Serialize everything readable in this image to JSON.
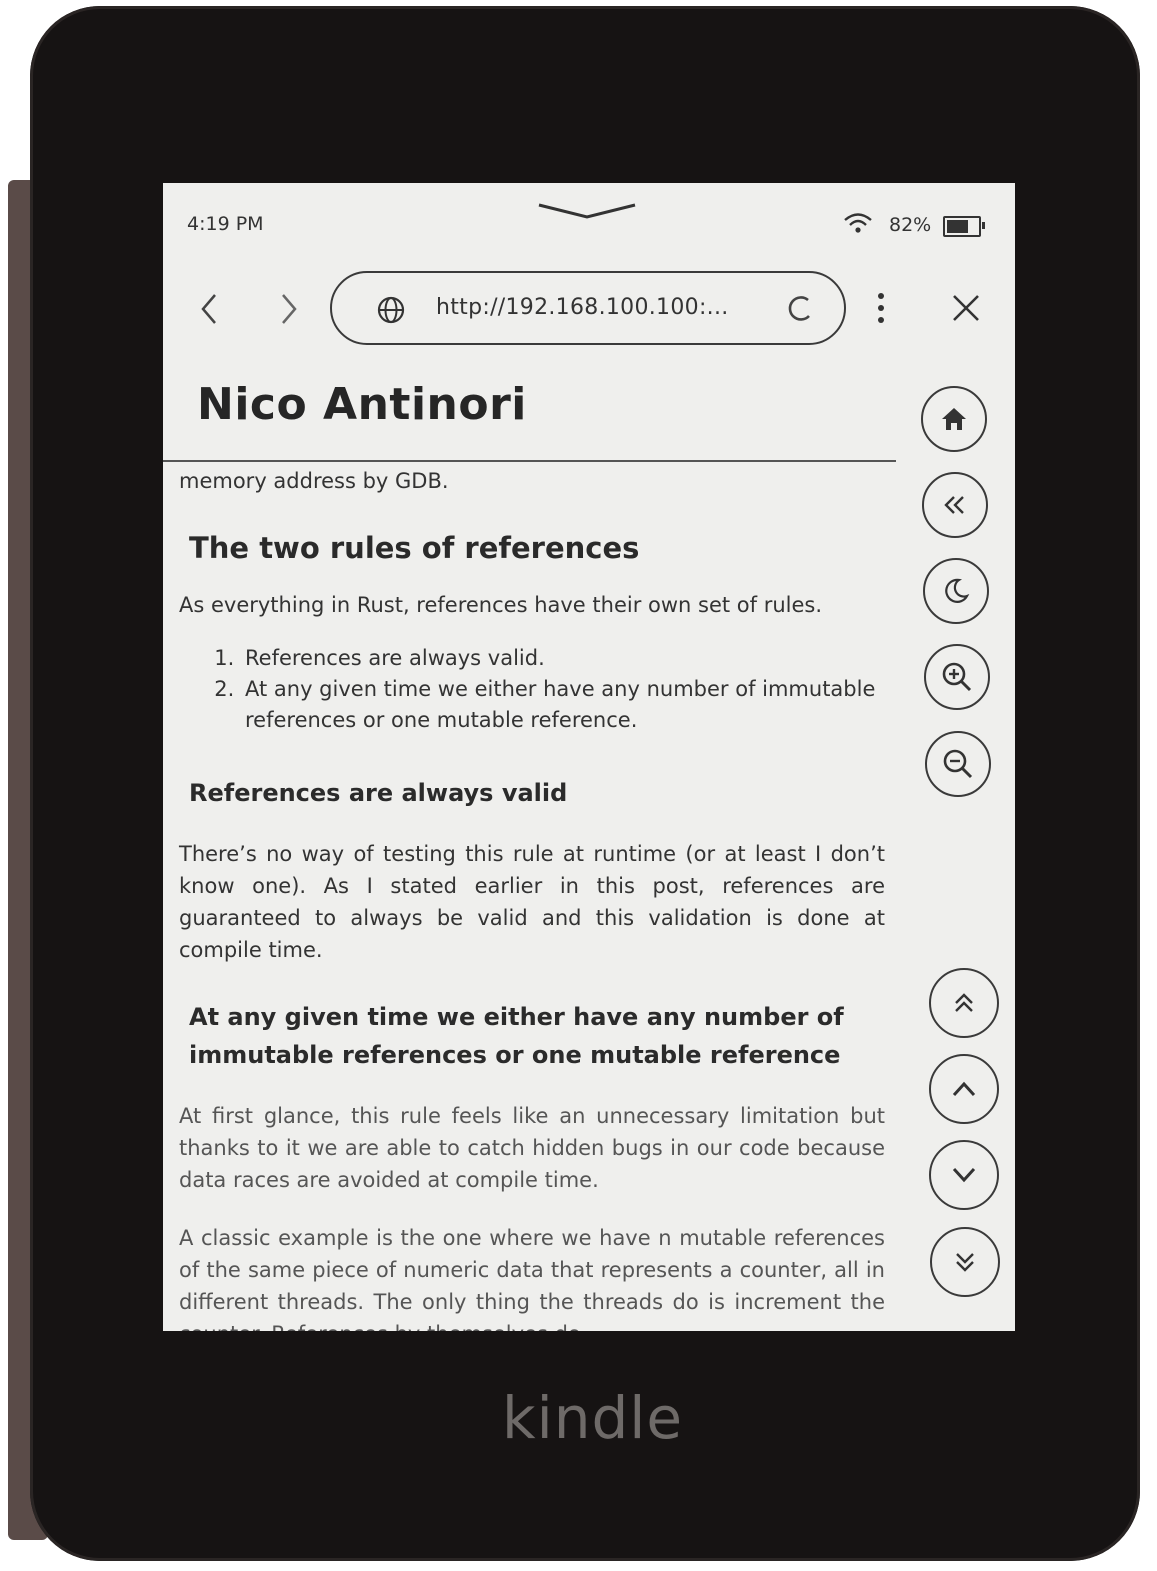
{
  "status": {
    "time": "4:19 PM",
    "battery": "82%",
    "battery_level": 0.82
  },
  "browser": {
    "url": "http://192.168.100.100:...",
    "icons": {
      "back": "chevron-left-icon",
      "forward": "chevron-right-icon",
      "globe": "globe-icon",
      "reload": "reload-icon",
      "more": "more-vertical-icon",
      "close": "close-icon"
    }
  },
  "page": {
    "site_title": "Nico Antinori",
    "intro_fragment": "memory address by GDB.",
    "heading_rules": "The two rules of references",
    "rules_intro": "As everything in Rust, references have their own set of rules.",
    "rules": [
      "References are always valid.",
      "At any given time we either have any number of immutable references or one mutable reference."
    ],
    "heading_valid": "References are always valid",
    "para_valid": "There’s no way of testing this rule at runtime (or at least I don’t know one). As I stated earlier in this post, references are guaranteed to always be valid and this validation is done at compile time.",
    "heading_mutable": "At any given time we either have any number of immutable references or one mutable reference",
    "para_glance": "At first glance, this rule feels like an unnecessary limitation but thanks to it we are able to catch hidden bugs in our code because data races are avoided at compile time.",
    "para_classic": "A classic example is the one where we have n mutable references of the same piece of numeric data that represents a counter, all in different threads. The only thing the threads do is increment the counter. References by themselves do"
  },
  "side_buttons": [
    "home-icon",
    "rewind-icon",
    "moon-icon",
    "zoom-in-icon",
    "zoom-out-icon",
    "page-top-icon",
    "page-up-icon",
    "page-down-icon",
    "page-bottom-icon"
  ],
  "device": {
    "brand": "kindle"
  }
}
